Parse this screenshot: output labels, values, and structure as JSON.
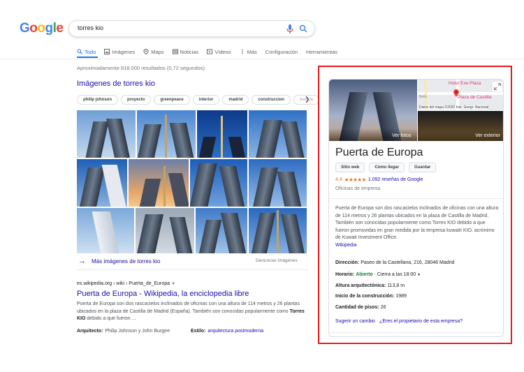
{
  "logo": {
    "letters": [
      "G",
      "o",
      "o",
      "g",
      "l",
      "e"
    ],
    "colors": [
      "#4285f4",
      "#ea4335",
      "#fbbc05",
      "#4285f4",
      "#34a853",
      "#ea4335"
    ]
  },
  "search": {
    "query": "torres kio"
  },
  "tabs": [
    {
      "label": "Todo",
      "icon": "search-icon",
      "active": true
    },
    {
      "label": "Imágenes",
      "icon": "image-icon"
    },
    {
      "label": "Maps",
      "icon": "map-pin-icon"
    },
    {
      "label": "Noticias",
      "icon": "news-icon"
    },
    {
      "label": "Vídeos",
      "icon": "video-icon"
    },
    {
      "label": "Más",
      "icon": "more-vert-icon"
    },
    {
      "label": "Configuración"
    },
    {
      "label": "Herramientas"
    }
  ],
  "stats": "Aproximadamente 818.000 resultados (0,72 segundos)",
  "images_section": {
    "heading": "Imágenes de torres kio",
    "chips": [
      "philip johnson",
      "proyecto",
      "greenpeace",
      "interior",
      "madrid",
      "construccion",
      "bankia"
    ],
    "more_link": "Más imágenes de torres kio",
    "report": "Denunciar imágenes"
  },
  "result": {
    "url": "es.wikipedia.org › wiki › Puerta_de_Europa",
    "title": "Puerta de Europa - Wikipedia, la enciclopedia libre",
    "snippet_1": "Puerta de Europa son dos rascacielos inclinados de oficinas con una altura de 114 metros y 26 plantas ubicados en la plaza de Castilla de Madrid (España). También son conocidas popularmente como ",
    "snippet_bold": "Torres KIO",
    "snippet_2": " debido a que fueron ...",
    "meta_arch_key": "Arquitecto:",
    "meta_arch_val": "Philip Johnson y John Burgee",
    "meta_style_key": "Estilo:",
    "meta_style_val": "arquitectura postmoderna"
  },
  "panel": {
    "map_label_hotel": "Hotel Exe Plaza",
    "map_label_plaza": "Plaza de Castilla",
    "map_label_bello": "Bello",
    "map_credit": "Datos del mapa ©2020 Inst. Geogr. Nacional",
    "ver_fotos": "Ver fotos",
    "ver_exterior": "Ver exterior",
    "title": "Puerta de Europa",
    "buttons": [
      "Sitio web",
      "Cómo llegar",
      "Guardar"
    ],
    "rating": "4,4",
    "stars": "★★★★★",
    "reviews": "1.092 reseñas de Google",
    "category": "Oficinas de empresa",
    "description": "Puerta de Europa son dos rascacielos inclinados de oficinas con una altura de 114 metros y 26 plantas ubicados en la plaza de Castilla de Madrid. También son conocidas popularmente como Torres KIO debido a que fueron promovidas en gran medida por la empresa kuwaití KIO, acrónimo de Kuwait Investment Office.",
    "desc_link": "Wikipedia",
    "direccion_k": "Dirección:",
    "direccion_v": "Paseo de la Castellana, 216, 28046 Madrid",
    "horario_k": "Horario:",
    "horario_open": "Abierto",
    "horario_v": " · Cierra a las 18:00",
    "altura_k": "Altura arquitectónica:",
    "altura_v": "113,8 m",
    "inicio_k": "Inicio de la construcción:",
    "inicio_v": "1989",
    "pisos_k": "Cantidad de pisos:",
    "pisos_v": "26",
    "link_change": "Sugerir un cambio",
    "link_dot": " · ",
    "link_owner": "¿Eres el propietario de esta empresa?"
  }
}
